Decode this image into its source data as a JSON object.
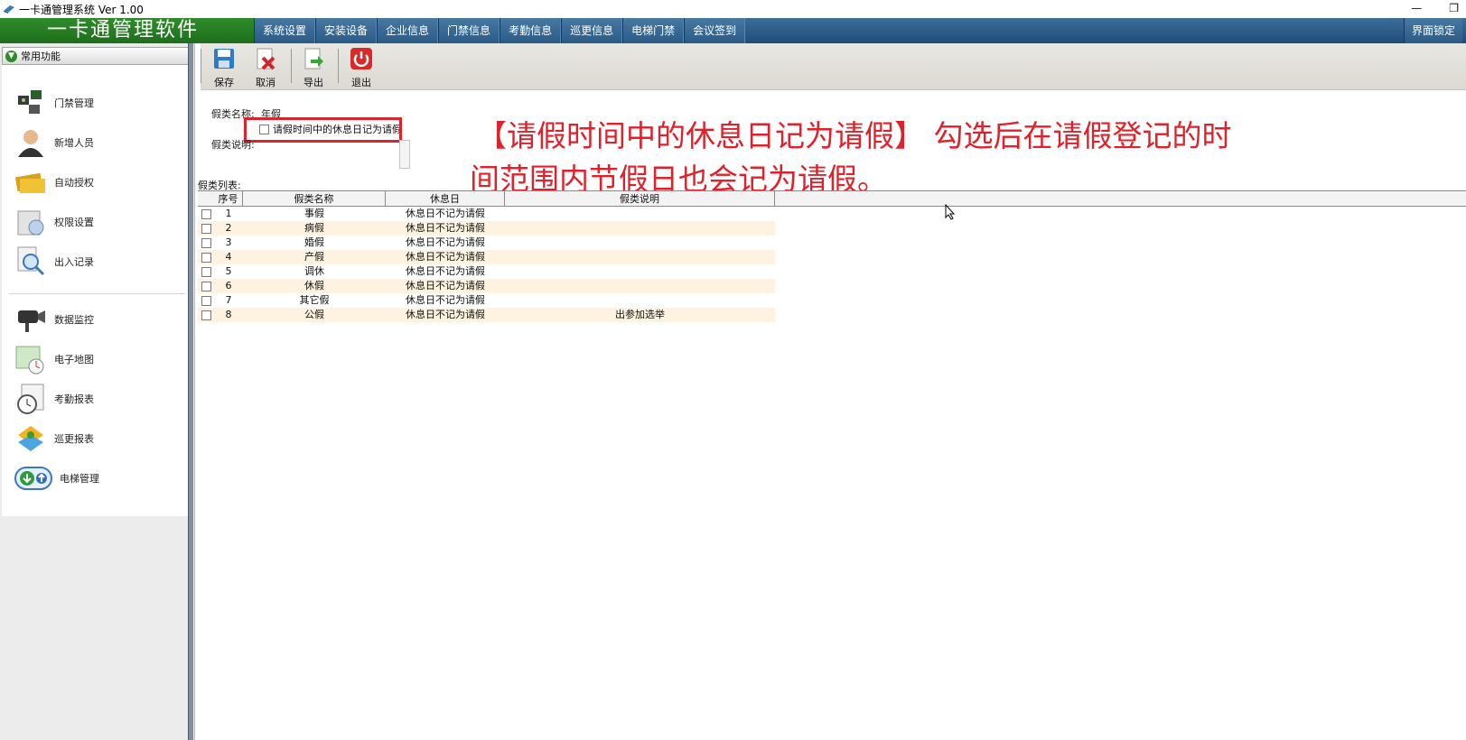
{
  "window": {
    "title": "一卡通管理系统  Ver 1.00",
    "brand": "一卡通管理软件",
    "lock_label": "界面锁定"
  },
  "menu": [
    "系统设置",
    "安装设备",
    "企业信息",
    "门禁信息",
    "考勤信息",
    "巡更信息",
    "电梯门禁",
    "会议签到"
  ],
  "sidebar": {
    "header": "常用功能",
    "group1": [
      {
        "label": "门禁管理",
        "icon": "door-control-icon"
      },
      {
        "label": "新增人员",
        "icon": "person-icon"
      },
      {
        "label": "自动授权",
        "icon": "card-icon"
      },
      {
        "label": "权限设置",
        "icon": "permission-icon"
      },
      {
        "label": "出入记录",
        "icon": "search-record-icon"
      }
    ],
    "group2": [
      {
        "label": "数据监控",
        "icon": "camera-icon"
      },
      {
        "label": "电子地图",
        "icon": "map-icon"
      },
      {
        "label": "考勤报表",
        "icon": "clock-icon"
      },
      {
        "label": "巡更报表",
        "icon": "patrol-icon"
      },
      {
        "label": "电梯管理",
        "icon": "elevator-icon"
      }
    ]
  },
  "toolbar": {
    "save": "保存",
    "cancel": "取消",
    "export": "导出",
    "exit": "退出"
  },
  "form": {
    "name_label": "假类名称:",
    "name_value": "年假",
    "checkbox_label": "请假时间中的休息日记为请假",
    "desc_label": "假类说明:"
  },
  "annotation": {
    "line1": "【请假时间中的休息日记为请假】 勾选后在请假登记的时",
    "line2": "间范围内节假日也会记为请假。"
  },
  "table": {
    "title": "假类列表:",
    "headers": {
      "no": "序号",
      "name": "假类名称",
      "rest": "休息日",
      "desc": "假类说明"
    },
    "rows": [
      {
        "no": "1",
        "name": "事假",
        "rest": "休息日不记为请假",
        "desc": ""
      },
      {
        "no": "2",
        "name": "病假",
        "rest": "休息日不记为请假",
        "desc": ""
      },
      {
        "no": "3",
        "name": "婚假",
        "rest": "休息日不记为请假",
        "desc": ""
      },
      {
        "no": "4",
        "name": "产假",
        "rest": "休息日不记为请假",
        "desc": ""
      },
      {
        "no": "5",
        "name": "调休",
        "rest": "休息日不记为请假",
        "desc": ""
      },
      {
        "no": "6",
        "name": "休假",
        "rest": "休息日不记为请假",
        "desc": ""
      },
      {
        "no": "7",
        "name": "其它假",
        "rest": "休息日不记为请假",
        "desc": ""
      },
      {
        "no": "8",
        "name": "公假",
        "rest": "休息日不记为请假",
        "desc": "出参加选举"
      }
    ]
  },
  "colors": {
    "menu_bg": "#2a5a86",
    "brand_bg": "#1e6e1c",
    "accent_red": "#d9252b",
    "row_alt": "#fdf3e0"
  }
}
